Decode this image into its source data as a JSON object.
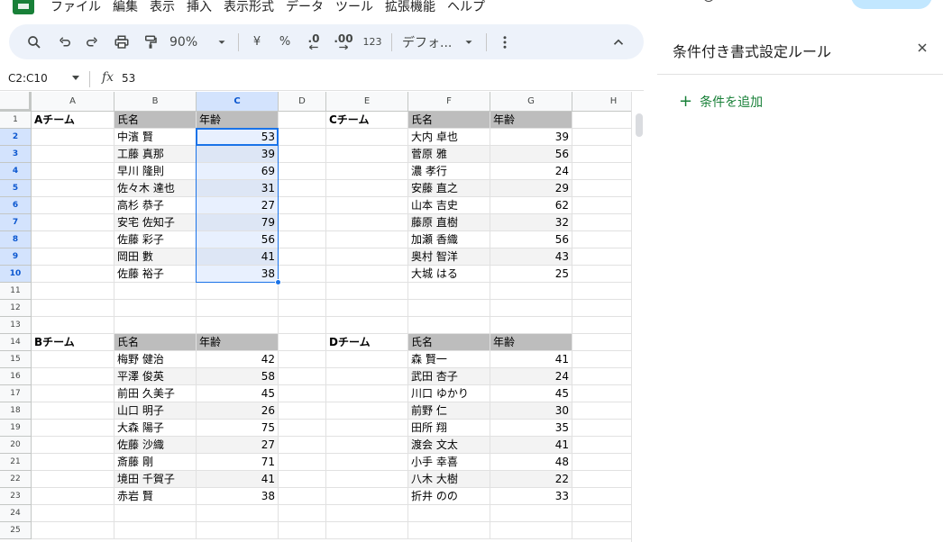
{
  "menu": [
    "ファイル",
    "編集",
    "表示",
    "挿入",
    "表示形式",
    "データ",
    "ツール",
    "拡張機能",
    "ヘルプ"
  ],
  "toolbar": {
    "zoom": "90%",
    "currency": "¥",
    "percent": "%",
    "dec_decrease": ".0",
    "dec_increase": ".00",
    "number_format": "123",
    "font": "デフォ..."
  },
  "formula_bar": {
    "name_box": "C2:C10",
    "fx": "fx",
    "value": "53"
  },
  "grid": {
    "columns": [
      "A",
      "B",
      "C",
      "D",
      "E",
      "F",
      "G",
      "H"
    ],
    "rows": [
      "1",
      "2",
      "3",
      "4",
      "5",
      "6",
      "7",
      "8",
      "9",
      "10",
      "11",
      "12",
      "13",
      "14",
      "15",
      "16",
      "17",
      "18",
      "19",
      "20",
      "21",
      "22",
      "23",
      "24",
      "25"
    ],
    "team_a": {
      "team": "Aチーム",
      "name_header": "氏名",
      "age_header": "年齢",
      "members": [
        {
          "name": "中濱 賢",
          "age": "53"
        },
        {
          "name": "工藤 真那",
          "age": "39"
        },
        {
          "name": "早川 隆則",
          "age": "69"
        },
        {
          "name": "佐々木 達也",
          "age": "31"
        },
        {
          "name": "高杉 恭子",
          "age": "27"
        },
        {
          "name": "安宅 佐知子",
          "age": "79"
        },
        {
          "name": "佐藤 彩子",
          "age": "56"
        },
        {
          "name": "岡田 數",
          "age": "41"
        },
        {
          "name": "佐藤 裕子",
          "age": "38"
        }
      ]
    },
    "team_b": {
      "team": "Bチーム",
      "name_header": "氏名",
      "age_header": "年齢",
      "members": [
        {
          "name": "梅野 健治",
          "age": "42"
        },
        {
          "name": "平澤 俊英",
          "age": "58"
        },
        {
          "name": "前田 久美子",
          "age": "45"
        },
        {
          "name": "山口 明子",
          "age": "26"
        },
        {
          "name": "大森 陽子",
          "age": "75"
        },
        {
          "name": "佐藤 沙織",
          "age": "27"
        },
        {
          "name": "斎藤 剛",
          "age": "71"
        },
        {
          "name": "境田 千賀子",
          "age": "41"
        },
        {
          "name": "赤岩 賢",
          "age": "38"
        }
      ]
    },
    "team_c": {
      "team": "Cチーム",
      "name_header": "氏名",
      "age_header": "年齢",
      "members": [
        {
          "name": "大内 卓也",
          "age": "39"
        },
        {
          "name": "菅原 雅",
          "age": "56"
        },
        {
          "name": "濃 孝行",
          "age": "24"
        },
        {
          "name": "安藤 直之",
          "age": "29"
        },
        {
          "name": "山本 吉史",
          "age": "62"
        },
        {
          "name": "藤原 直樹",
          "age": "32"
        },
        {
          "name": "加瀬 香織",
          "age": "56"
        },
        {
          "name": "奥村 智洋",
          "age": "43"
        },
        {
          "name": "大城 はる",
          "age": "25"
        }
      ]
    },
    "team_d": {
      "team": "Dチーム",
      "name_header": "氏名",
      "age_header": "年齢",
      "members": [
        {
          "name": "森 賢一",
          "age": "41"
        },
        {
          "name": "武田 杏子",
          "age": "24"
        },
        {
          "name": "川口 ゆかり",
          "age": "45"
        },
        {
          "name": "前野 仁",
          "age": "30"
        },
        {
          "name": "田所 翔",
          "age": "35"
        },
        {
          "name": "渡会 文太",
          "age": "41"
        },
        {
          "name": "小手 幸喜",
          "age": "48"
        },
        {
          "name": "八木 大樹",
          "age": "22"
        },
        {
          "name": "折井 のの",
          "age": "33"
        }
      ]
    }
  },
  "side_panel": {
    "title": "条件付き書式設定ルール",
    "add_icon": "+",
    "add_label": "条件を追加"
  },
  "colors": {
    "accent": "#1a73e8",
    "header_fill": "#bdbdbd",
    "band_fill": "#f3f3f3",
    "add_green": "#188038",
    "toolbar_bg": "#edf2fa"
  }
}
